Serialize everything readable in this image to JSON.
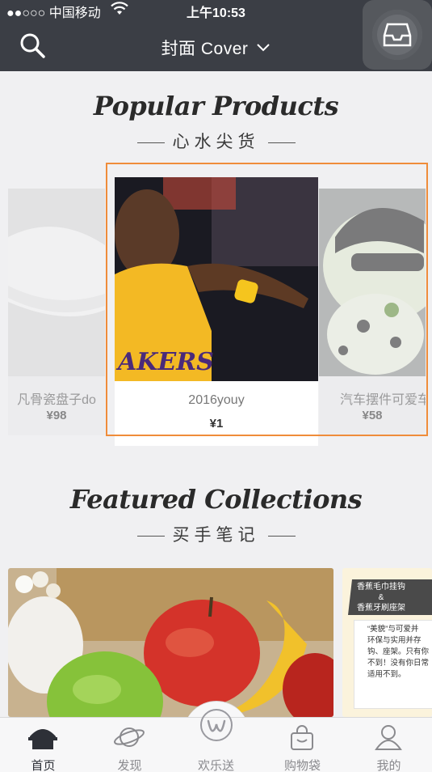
{
  "status_bar": {
    "carrier": "●●○○○ 中国移动",
    "time": "上午10:53"
  },
  "header": {
    "title": "封面 Cover",
    "title_chevron": "∨",
    "search_icon": "search-icon",
    "tray_icon": "inbox-tray-icon"
  },
  "popular": {
    "title": "Popular Products",
    "subtitle": "心水尖货",
    "items": [
      {
        "name": "凡骨瓷盘子do",
        "price": "¥98"
      },
      {
        "name": "2016youy",
        "price": "¥1"
      },
      {
        "name": "汽车摆件可爱车",
        "price": "¥58"
      }
    ]
  },
  "featured": {
    "title": "Featured Collections",
    "subtitle": "买手笔记",
    "side_card": {
      "heading_line1": "香蕉毛巾挂钩",
      "heading_amp": "&",
      "heading_line2": "香蕉牙刷座架",
      "body_lines": [
        "“美貌”与可爱并",
        "环保与实用并存",
        "钩、座架。只有你",
        "不到！没有你日常",
        "适用不到。"
      ]
    }
  },
  "tabbar": {
    "tabs": [
      {
        "label": "首页",
        "icon": "home-icon"
      },
      {
        "label": "发现",
        "icon": "planet-icon"
      },
      {
        "label": "欢乐送",
        "icon": "w-logo-icon"
      },
      {
        "label": "购物袋",
        "icon": "shopping-bag-icon"
      },
      {
        "label": "我的",
        "icon": "profile-icon"
      }
    ]
  },
  "colors": {
    "header_bg": "#3b3e45",
    "accent_frame": "#ef8c3a",
    "page_bg": "#f0f0f2"
  }
}
